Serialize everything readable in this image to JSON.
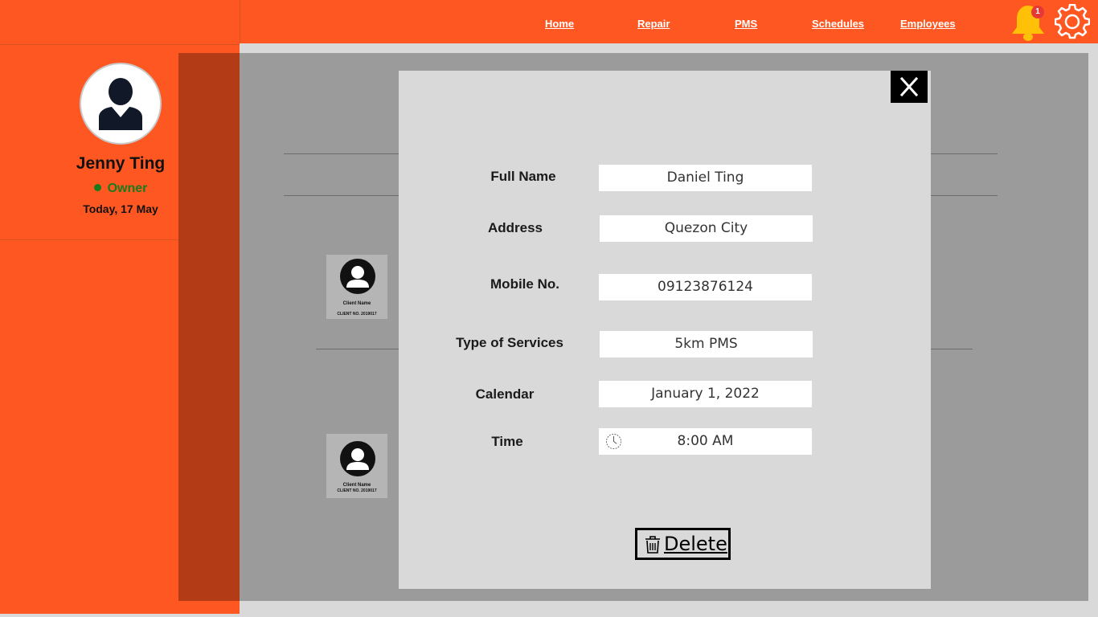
{
  "nav": {
    "links": [
      "Home",
      "Repair",
      "PMS",
      "Schedules",
      "Employees"
    ],
    "notification_count": "1",
    "icons": [
      "bell-icon",
      "gear-icon"
    ]
  },
  "sidebar": {
    "user_name": "Jenny Ting",
    "role": "Owner",
    "date": "Today, 17 May"
  },
  "background_clients": [
    {
      "name": "Client Name",
      "number": "CLIENT NO. 2019017"
    },
    {
      "name": "Client Name",
      "number": "CLIENT NO. 2019017"
    }
  ],
  "modal": {
    "fields": [
      {
        "label": "Full Name",
        "value": "Daniel Ting"
      },
      {
        "label": "Address",
        "value": "Quezon City"
      },
      {
        "label": "Mobile No.",
        "value": "09123876124"
      },
      {
        "label": "Type of Services",
        "value": "5km PMS"
      },
      {
        "label": "Calendar",
        "value": "January 1, 2022"
      },
      {
        "label": "Time",
        "value": "8:00 AM"
      }
    ],
    "delete_label": "Delete"
  },
  "colors": {
    "brand_orange": "#ff5722",
    "owner_green": "#1b7a1b",
    "overlay_gray": "#9b9b9b",
    "modal_bg": "#d9d9d9"
  }
}
